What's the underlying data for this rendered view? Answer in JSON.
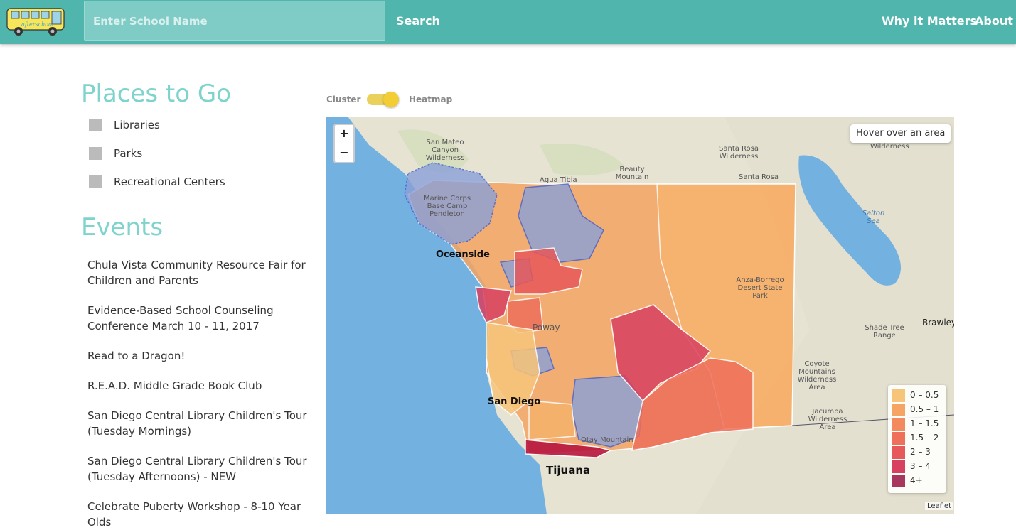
{
  "header": {
    "logo_text": "afterschool",
    "search_placeholder": "Enter School Name",
    "search_button": "Search",
    "nav": [
      {
        "label": "Why it Matters"
      },
      {
        "label": "About"
      }
    ]
  },
  "places": {
    "title": "Places to Go",
    "items": [
      {
        "label": "Libraries"
      },
      {
        "label": "Parks"
      },
      {
        "label": "Recreational Centers"
      }
    ]
  },
  "events": {
    "title": "Events",
    "items": [
      {
        "title": "Chula Vista Community Resource Fair for Children and Parents"
      },
      {
        "title": "Evidence-Based School Counseling Conference March 10 - 11, 2017"
      },
      {
        "title": "Read to a Dragon!"
      },
      {
        "title": "R.E.A.D. Middle Grade Book Club"
      },
      {
        "title": "San Diego Central Library Children's Tour (Tuesday Mornings)"
      },
      {
        "title": "San Diego Central Library Children's Tour (Tuesday Afternoons) - NEW"
      },
      {
        "title": "Celebrate Puberty Workshop - 8-10 Year Olds"
      }
    ]
  },
  "toggle": {
    "left_label": "Cluster",
    "right_label": "Heatmap",
    "state": "Heatmap"
  },
  "map": {
    "zoom_in": "+",
    "zoom_out": "−",
    "info_box": "Hover over an area",
    "attribution": "Leaflet",
    "legend": [
      {
        "label": "0 – 0.5",
        "color": "#f7c57a"
      },
      {
        "label": "0.5 – 1",
        "color": "#f5a463"
      },
      {
        "label": "1 – 1.5",
        "color": "#f38a5e"
      },
      {
        "label": "1.5 – 2",
        "color": "#ee6f5a"
      },
      {
        "label": "2 – 3",
        "color": "#e7585a"
      },
      {
        "label": "3 – 4",
        "color": "#d84060"
      },
      {
        "label": "4+",
        "color": "#a7375e"
      }
    ],
    "place_labels": {
      "oceanside": "Oceanside",
      "san_diego": "San Diego",
      "tijuana": "Tijuana",
      "poway": "Poway",
      "pendleton": "Marine Corps Base Camp Pendleton",
      "san_mateo": "San Mateo Canyon Wilderness",
      "beauty": "Beauty Mountain",
      "agua_tibia": "Agua Tibia",
      "santa_rosa": "Santa Rosa Wilderness",
      "santa_rosa2": "Santa Rosa",
      "anza": "Anza-Borrego Desert State Park",
      "salton": "Salton Sea",
      "shade_tree": "Shade Tree Range",
      "brawley": "Brawley",
      "coyote": "Coyote Mountains Wilderness Area",
      "jacumba": "Jacumba Wilderness Area",
      "otay": "Otay Mountain",
      "wilderness": "Wilderness"
    }
  }
}
